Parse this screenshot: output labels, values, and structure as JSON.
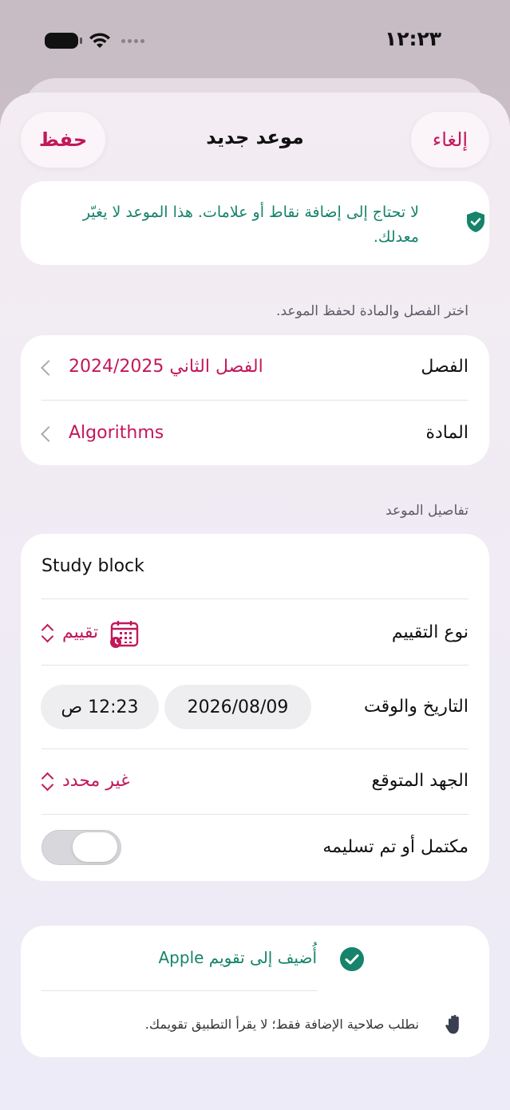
{
  "status_bar": {
    "time": "١٢:٢٣"
  },
  "nav": {
    "title": "موعد جديد",
    "save_label": "حفظ",
    "cancel_label": "إلغاء"
  },
  "notice": {
    "text": "لا تحتاج إلى إضافة نقاط أو علامات. هذا الموعد لا يغيّر معدلك."
  },
  "course_section": {
    "caption": "اختر الفصل والمادة لحفظ الموعد.",
    "semester_label": "الفصل",
    "semester_value": "الفصل الثاني 2024/2025",
    "subject_label": "المادة",
    "subject_value": "Algorithms"
  },
  "details_section": {
    "caption": "تفاصيل الموعد",
    "title_value": "Study block",
    "type_label": "نوع التقييم",
    "type_value": "تقييم",
    "datetime_label": "التاريخ والوقت",
    "date_value": "2026/08/09",
    "time_value": "12:23 ص",
    "effort_label": "الجهد المتوقع",
    "effort_value": "غير محدد",
    "completed_label": "مكتمل أو تم تسليمه",
    "completed_on": false
  },
  "calendar_section": {
    "add_label": "أُضيف إلى تقويم Apple",
    "permission_note": "نطلب صلاحية الإضافة فقط؛ لا يقرأ التطبيق تقويمك."
  },
  "colors": {
    "accent": "#c2185b",
    "success": "#16836a"
  }
}
